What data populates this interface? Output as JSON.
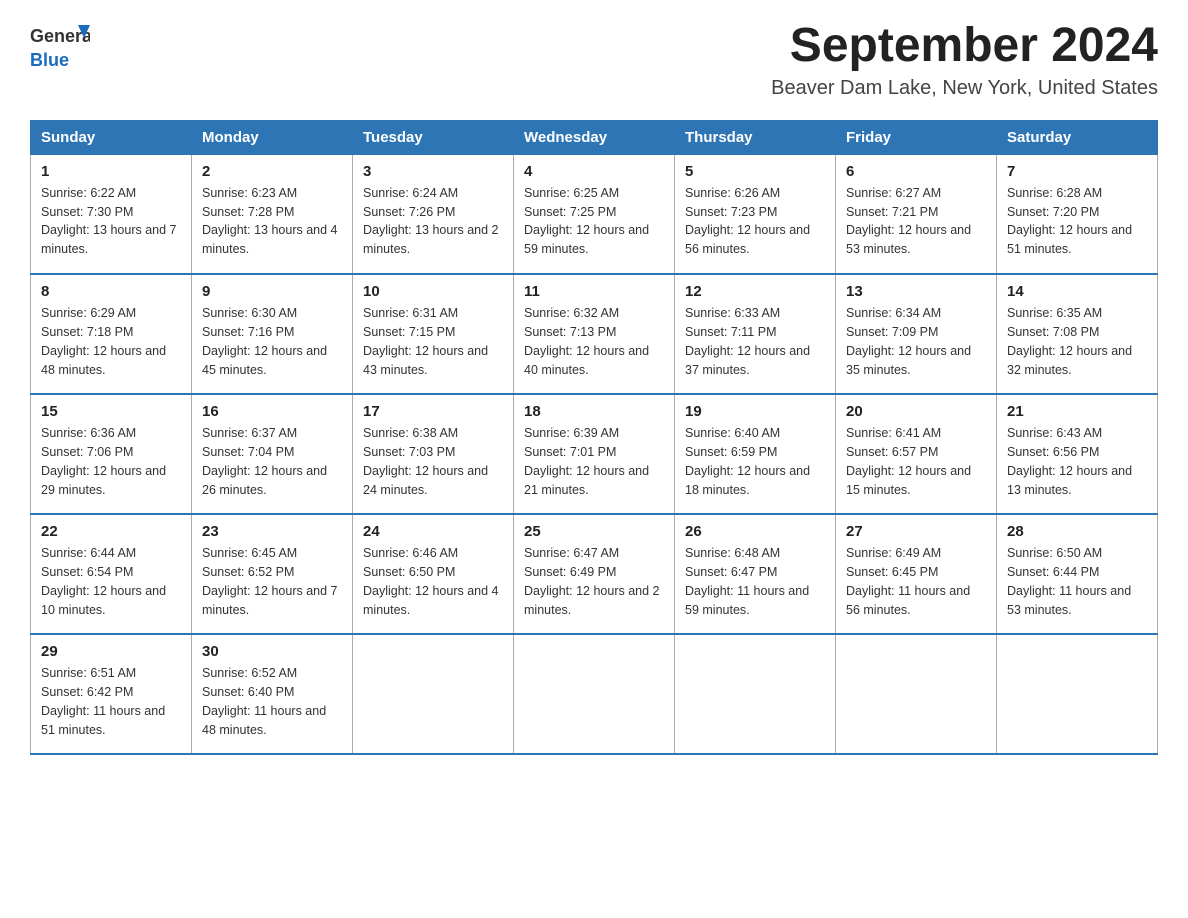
{
  "header": {
    "logo_text_part1": "General",
    "logo_text_part2": "Blue",
    "month_title": "September 2024",
    "location": "Beaver Dam Lake, New York, United States"
  },
  "weekdays": [
    "Sunday",
    "Monday",
    "Tuesday",
    "Wednesday",
    "Thursday",
    "Friday",
    "Saturday"
  ],
  "weeks": [
    [
      {
        "day": "1",
        "sunrise": "6:22 AM",
        "sunset": "7:30 PM",
        "daylight": "13 hours and 7 minutes."
      },
      {
        "day": "2",
        "sunrise": "6:23 AM",
        "sunset": "7:28 PM",
        "daylight": "13 hours and 4 minutes."
      },
      {
        "day": "3",
        "sunrise": "6:24 AM",
        "sunset": "7:26 PM",
        "daylight": "13 hours and 2 minutes."
      },
      {
        "day": "4",
        "sunrise": "6:25 AM",
        "sunset": "7:25 PM",
        "daylight": "12 hours and 59 minutes."
      },
      {
        "day": "5",
        "sunrise": "6:26 AM",
        "sunset": "7:23 PM",
        "daylight": "12 hours and 56 minutes."
      },
      {
        "day": "6",
        "sunrise": "6:27 AM",
        "sunset": "7:21 PM",
        "daylight": "12 hours and 53 minutes."
      },
      {
        "day": "7",
        "sunrise": "6:28 AM",
        "sunset": "7:20 PM",
        "daylight": "12 hours and 51 minutes."
      }
    ],
    [
      {
        "day": "8",
        "sunrise": "6:29 AM",
        "sunset": "7:18 PM",
        "daylight": "12 hours and 48 minutes."
      },
      {
        "day": "9",
        "sunrise": "6:30 AM",
        "sunset": "7:16 PM",
        "daylight": "12 hours and 45 minutes."
      },
      {
        "day": "10",
        "sunrise": "6:31 AM",
        "sunset": "7:15 PM",
        "daylight": "12 hours and 43 minutes."
      },
      {
        "day": "11",
        "sunrise": "6:32 AM",
        "sunset": "7:13 PM",
        "daylight": "12 hours and 40 minutes."
      },
      {
        "day": "12",
        "sunrise": "6:33 AM",
        "sunset": "7:11 PM",
        "daylight": "12 hours and 37 minutes."
      },
      {
        "day": "13",
        "sunrise": "6:34 AM",
        "sunset": "7:09 PM",
        "daylight": "12 hours and 35 minutes."
      },
      {
        "day": "14",
        "sunrise": "6:35 AM",
        "sunset": "7:08 PM",
        "daylight": "12 hours and 32 minutes."
      }
    ],
    [
      {
        "day": "15",
        "sunrise": "6:36 AM",
        "sunset": "7:06 PM",
        "daylight": "12 hours and 29 minutes."
      },
      {
        "day": "16",
        "sunrise": "6:37 AM",
        "sunset": "7:04 PM",
        "daylight": "12 hours and 26 minutes."
      },
      {
        "day": "17",
        "sunrise": "6:38 AM",
        "sunset": "7:03 PM",
        "daylight": "12 hours and 24 minutes."
      },
      {
        "day": "18",
        "sunrise": "6:39 AM",
        "sunset": "7:01 PM",
        "daylight": "12 hours and 21 minutes."
      },
      {
        "day": "19",
        "sunrise": "6:40 AM",
        "sunset": "6:59 PM",
        "daylight": "12 hours and 18 minutes."
      },
      {
        "day": "20",
        "sunrise": "6:41 AM",
        "sunset": "6:57 PM",
        "daylight": "12 hours and 15 minutes."
      },
      {
        "day": "21",
        "sunrise": "6:43 AM",
        "sunset": "6:56 PM",
        "daylight": "12 hours and 13 minutes."
      }
    ],
    [
      {
        "day": "22",
        "sunrise": "6:44 AM",
        "sunset": "6:54 PM",
        "daylight": "12 hours and 10 minutes."
      },
      {
        "day": "23",
        "sunrise": "6:45 AM",
        "sunset": "6:52 PM",
        "daylight": "12 hours and 7 minutes."
      },
      {
        "day": "24",
        "sunrise": "6:46 AM",
        "sunset": "6:50 PM",
        "daylight": "12 hours and 4 minutes."
      },
      {
        "day": "25",
        "sunrise": "6:47 AM",
        "sunset": "6:49 PM",
        "daylight": "12 hours and 2 minutes."
      },
      {
        "day": "26",
        "sunrise": "6:48 AM",
        "sunset": "6:47 PM",
        "daylight": "11 hours and 59 minutes."
      },
      {
        "day": "27",
        "sunrise": "6:49 AM",
        "sunset": "6:45 PM",
        "daylight": "11 hours and 56 minutes."
      },
      {
        "day": "28",
        "sunrise": "6:50 AM",
        "sunset": "6:44 PM",
        "daylight": "11 hours and 53 minutes."
      }
    ],
    [
      {
        "day": "29",
        "sunrise": "6:51 AM",
        "sunset": "6:42 PM",
        "daylight": "11 hours and 51 minutes."
      },
      {
        "day": "30",
        "sunrise": "6:52 AM",
        "sunset": "6:40 PM",
        "daylight": "11 hours and 48 minutes."
      },
      null,
      null,
      null,
      null,
      null
    ]
  ]
}
